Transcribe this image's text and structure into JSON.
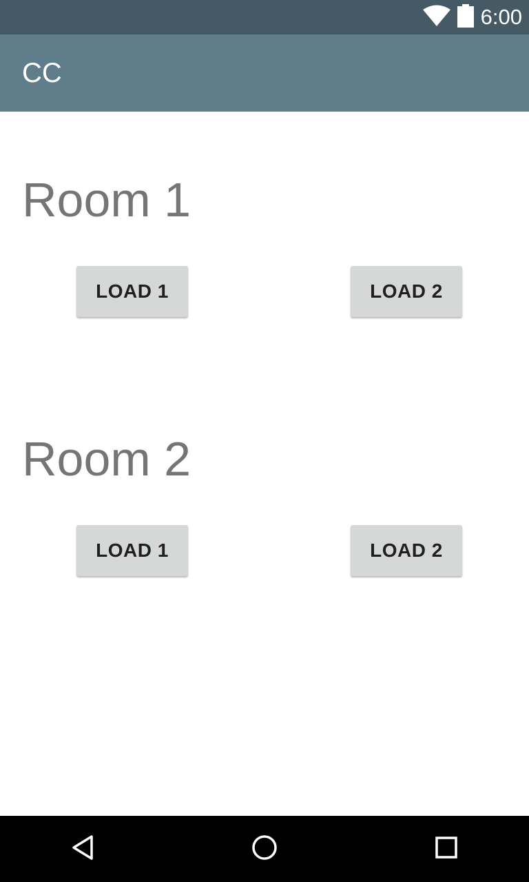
{
  "status_bar": {
    "time": "6:00",
    "icons": [
      "wifi-icon",
      "battery-icon"
    ]
  },
  "app_bar": {
    "title": "CC"
  },
  "rooms": [
    {
      "title": "Room 1",
      "buttons": [
        "LOAD 1",
        "LOAD 2"
      ]
    },
    {
      "title": "Room 2",
      "buttons": [
        "LOAD 1",
        "LOAD 2"
      ]
    }
  ],
  "nav_bar": {
    "icons": [
      "back-icon",
      "home-icon",
      "recents-icon"
    ]
  },
  "colors": {
    "status_bar": "#455a64",
    "app_bar": "#607d8b",
    "button": "#d6d7d7",
    "room_title": "#757575",
    "nav_bar": "#000000"
  }
}
